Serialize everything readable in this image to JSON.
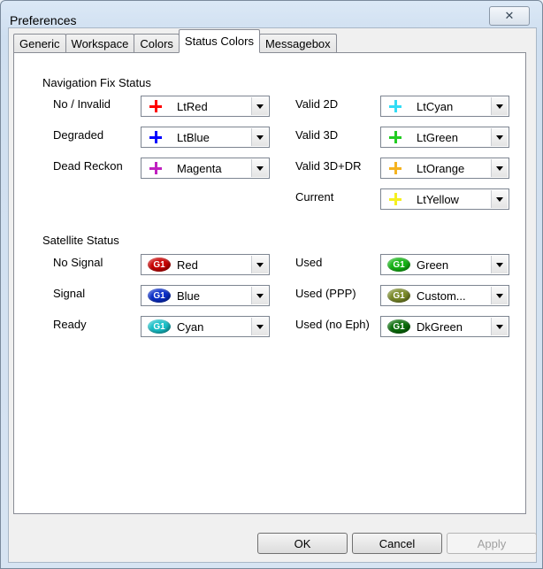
{
  "window": {
    "title": "Preferences",
    "close_glyph": "✕"
  },
  "tabs": [
    "Generic",
    "Workspace",
    "Colors",
    "Status Colors",
    "Messagebox"
  ],
  "active_tab": "Status Colors",
  "nav_fix": {
    "title": "Navigation Fix Status",
    "left": [
      {
        "label": "No / Invalid",
        "value": "LtRed",
        "color": "#ff0000"
      },
      {
        "label": "Degraded",
        "value": "LtBlue",
        "color": "#0000ff"
      },
      {
        "label": "Dead Reckon",
        "value": "Magenta",
        "color": "#c020c0"
      }
    ],
    "right": [
      {
        "label": "Valid 2D",
        "value": "LtCyan",
        "color": "#33dcf5"
      },
      {
        "label": "Valid 3D",
        "value": "LtGreen",
        "color": "#22cc22"
      },
      {
        "label": "Valid 3D+DR",
        "value": "LtOrange",
        "color": "#f5b31f"
      },
      {
        "label": "Current",
        "value": "LtYellow",
        "color": "#f5f020"
      }
    ]
  },
  "satellite": {
    "title": "Satellite Status",
    "badge_text": "G1",
    "left": [
      {
        "label": "No Signal",
        "value": "Red",
        "color": "#c80000"
      },
      {
        "label": "Signal",
        "value": "Blue",
        "color": "#0a2ec8"
      },
      {
        "label": "Ready",
        "value": "Cyan",
        "color": "#18c0c8"
      }
    ],
    "right": [
      {
        "label": "Used",
        "value": "Green",
        "color": "#14b414"
      },
      {
        "label": "Used (PPP)",
        "value": "Custom...",
        "color": "#7a8a28"
      },
      {
        "label": "Used (no Eph)",
        "value": "DkGreen",
        "color": "#0a6e0a"
      }
    ]
  },
  "buttons": {
    "ok": "OK",
    "cancel": "Cancel",
    "apply": "Apply"
  }
}
